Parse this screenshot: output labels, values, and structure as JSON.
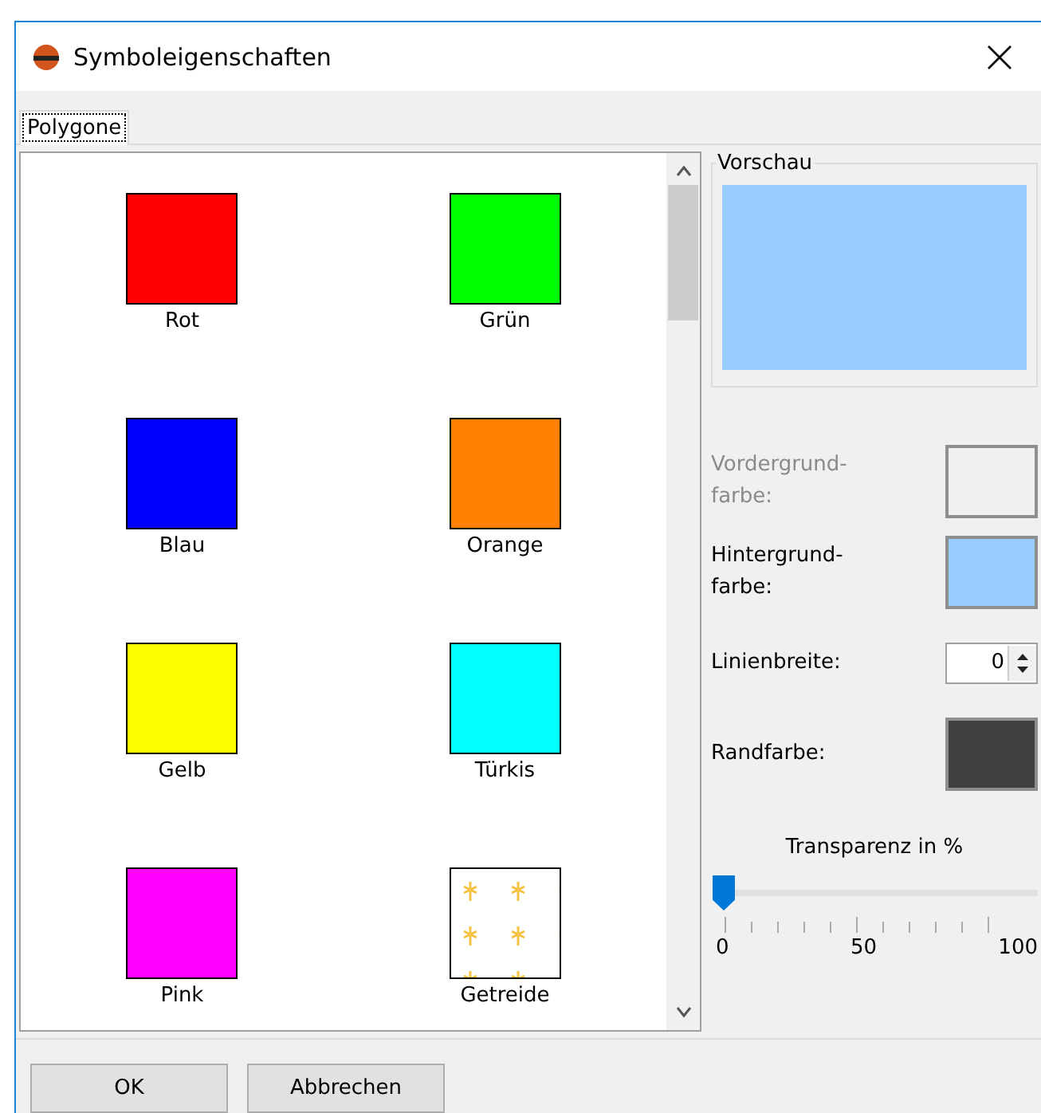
{
  "window": {
    "title": "Symboleigenschaften"
  },
  "tabs": [
    {
      "label": "Polygone",
      "selected": true
    }
  ],
  "symbols": [
    {
      "label": "Rot",
      "kind": "solid",
      "color": "#ff0000"
    },
    {
      "label": "Grün",
      "kind": "solid",
      "color": "#00ff00"
    },
    {
      "label": "Blau",
      "kind": "solid",
      "color": "#0000ff"
    },
    {
      "label": "Orange",
      "kind": "solid",
      "color": "#ff8000"
    },
    {
      "label": "Gelb",
      "kind": "solid",
      "color": "#ffff00"
    },
    {
      "label": "Türkis",
      "kind": "solid",
      "color": "#00ffff"
    },
    {
      "label": "Pink",
      "kind": "solid",
      "color": "#ff00ff"
    },
    {
      "label": "Getreide",
      "kind": "pattern",
      "color": "#f5c242"
    }
  ],
  "preview": {
    "label": "Vorschau",
    "color": "#99ccff"
  },
  "properties": [
    {
      "kind": "color",
      "label": "Vordergrund-\nfarbe:",
      "disabled": true,
      "color": "#f0f0f0"
    },
    {
      "kind": "color",
      "label": "Hintergrund-\nfarbe:",
      "disabled": false,
      "color": "#99ccff"
    },
    {
      "kind": "spinner",
      "label": "Linienbreite:",
      "disabled": false,
      "value": "0"
    },
    {
      "kind": "color",
      "label": "Randfarbe:",
      "disabled": false,
      "color": "#404040"
    }
  ],
  "transparency": {
    "label": "Transparenz in %",
    "level": 0,
    "ticks": [
      "0",
      "50",
      "100"
    ]
  },
  "buttons": [
    "OK",
    "Abbrechen"
  ]
}
